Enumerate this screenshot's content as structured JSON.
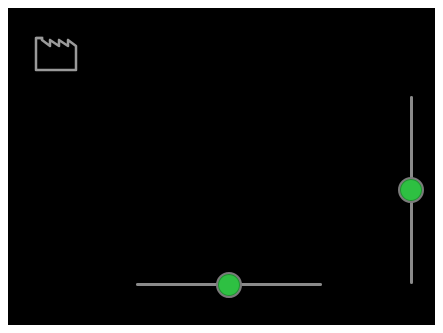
{
  "screen": {
    "mode_icon": "factory-icon",
    "background_color": "#000000"
  },
  "controls": {
    "horizontal_slider": {
      "value": 0.5,
      "track_color": "#8a8a8a",
      "knob_color": "#2ec042"
    },
    "vertical_slider": {
      "value": 0.5,
      "track_color": "#8a8a8a",
      "knob_color": "#2ec042"
    }
  }
}
